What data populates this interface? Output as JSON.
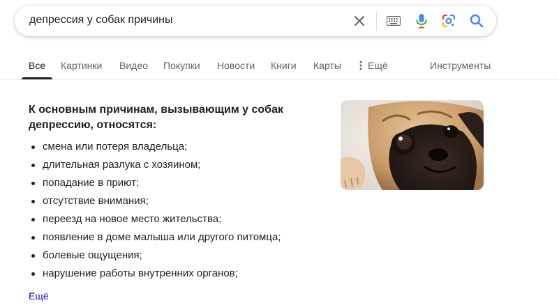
{
  "search": {
    "query": "депрессия у собак причины",
    "icons": [
      "close-icon",
      "keyboard-icon",
      "microphone-icon",
      "google-lens-icon",
      "search-icon"
    ]
  },
  "tabs": [
    {
      "label": "Все",
      "active": true
    },
    {
      "label": "Картинки"
    },
    {
      "label": "Видео"
    },
    {
      "label": "Покупки"
    },
    {
      "label": "Новости"
    },
    {
      "label": "Книги"
    },
    {
      "label": "Карты"
    },
    {
      "label": "Ещё",
      "icon": "more-vert-icon"
    },
    {
      "label": "Инструменты"
    }
  ],
  "answer": {
    "title": "К основным причинам, вызывающим у собак депрессию, относятся:",
    "items": [
      "смена или потеря владельца;",
      "длительная разлука с хозяином;",
      "попадание в приют;",
      "отсутствие внимания;",
      "переезд на новое место жительства;",
      "появление в доме малыша или другого питомца;",
      "болевые ощущения;",
      "нарушение работы внутренних органов;"
    ],
    "more_label": "Ещё",
    "image": {
      "subject": "pug-photo"
    }
  },
  "colors": {
    "text": "#202124",
    "secondary": "#5f6368",
    "link": "#1a0dab",
    "search_blue": "#4285f4"
  }
}
